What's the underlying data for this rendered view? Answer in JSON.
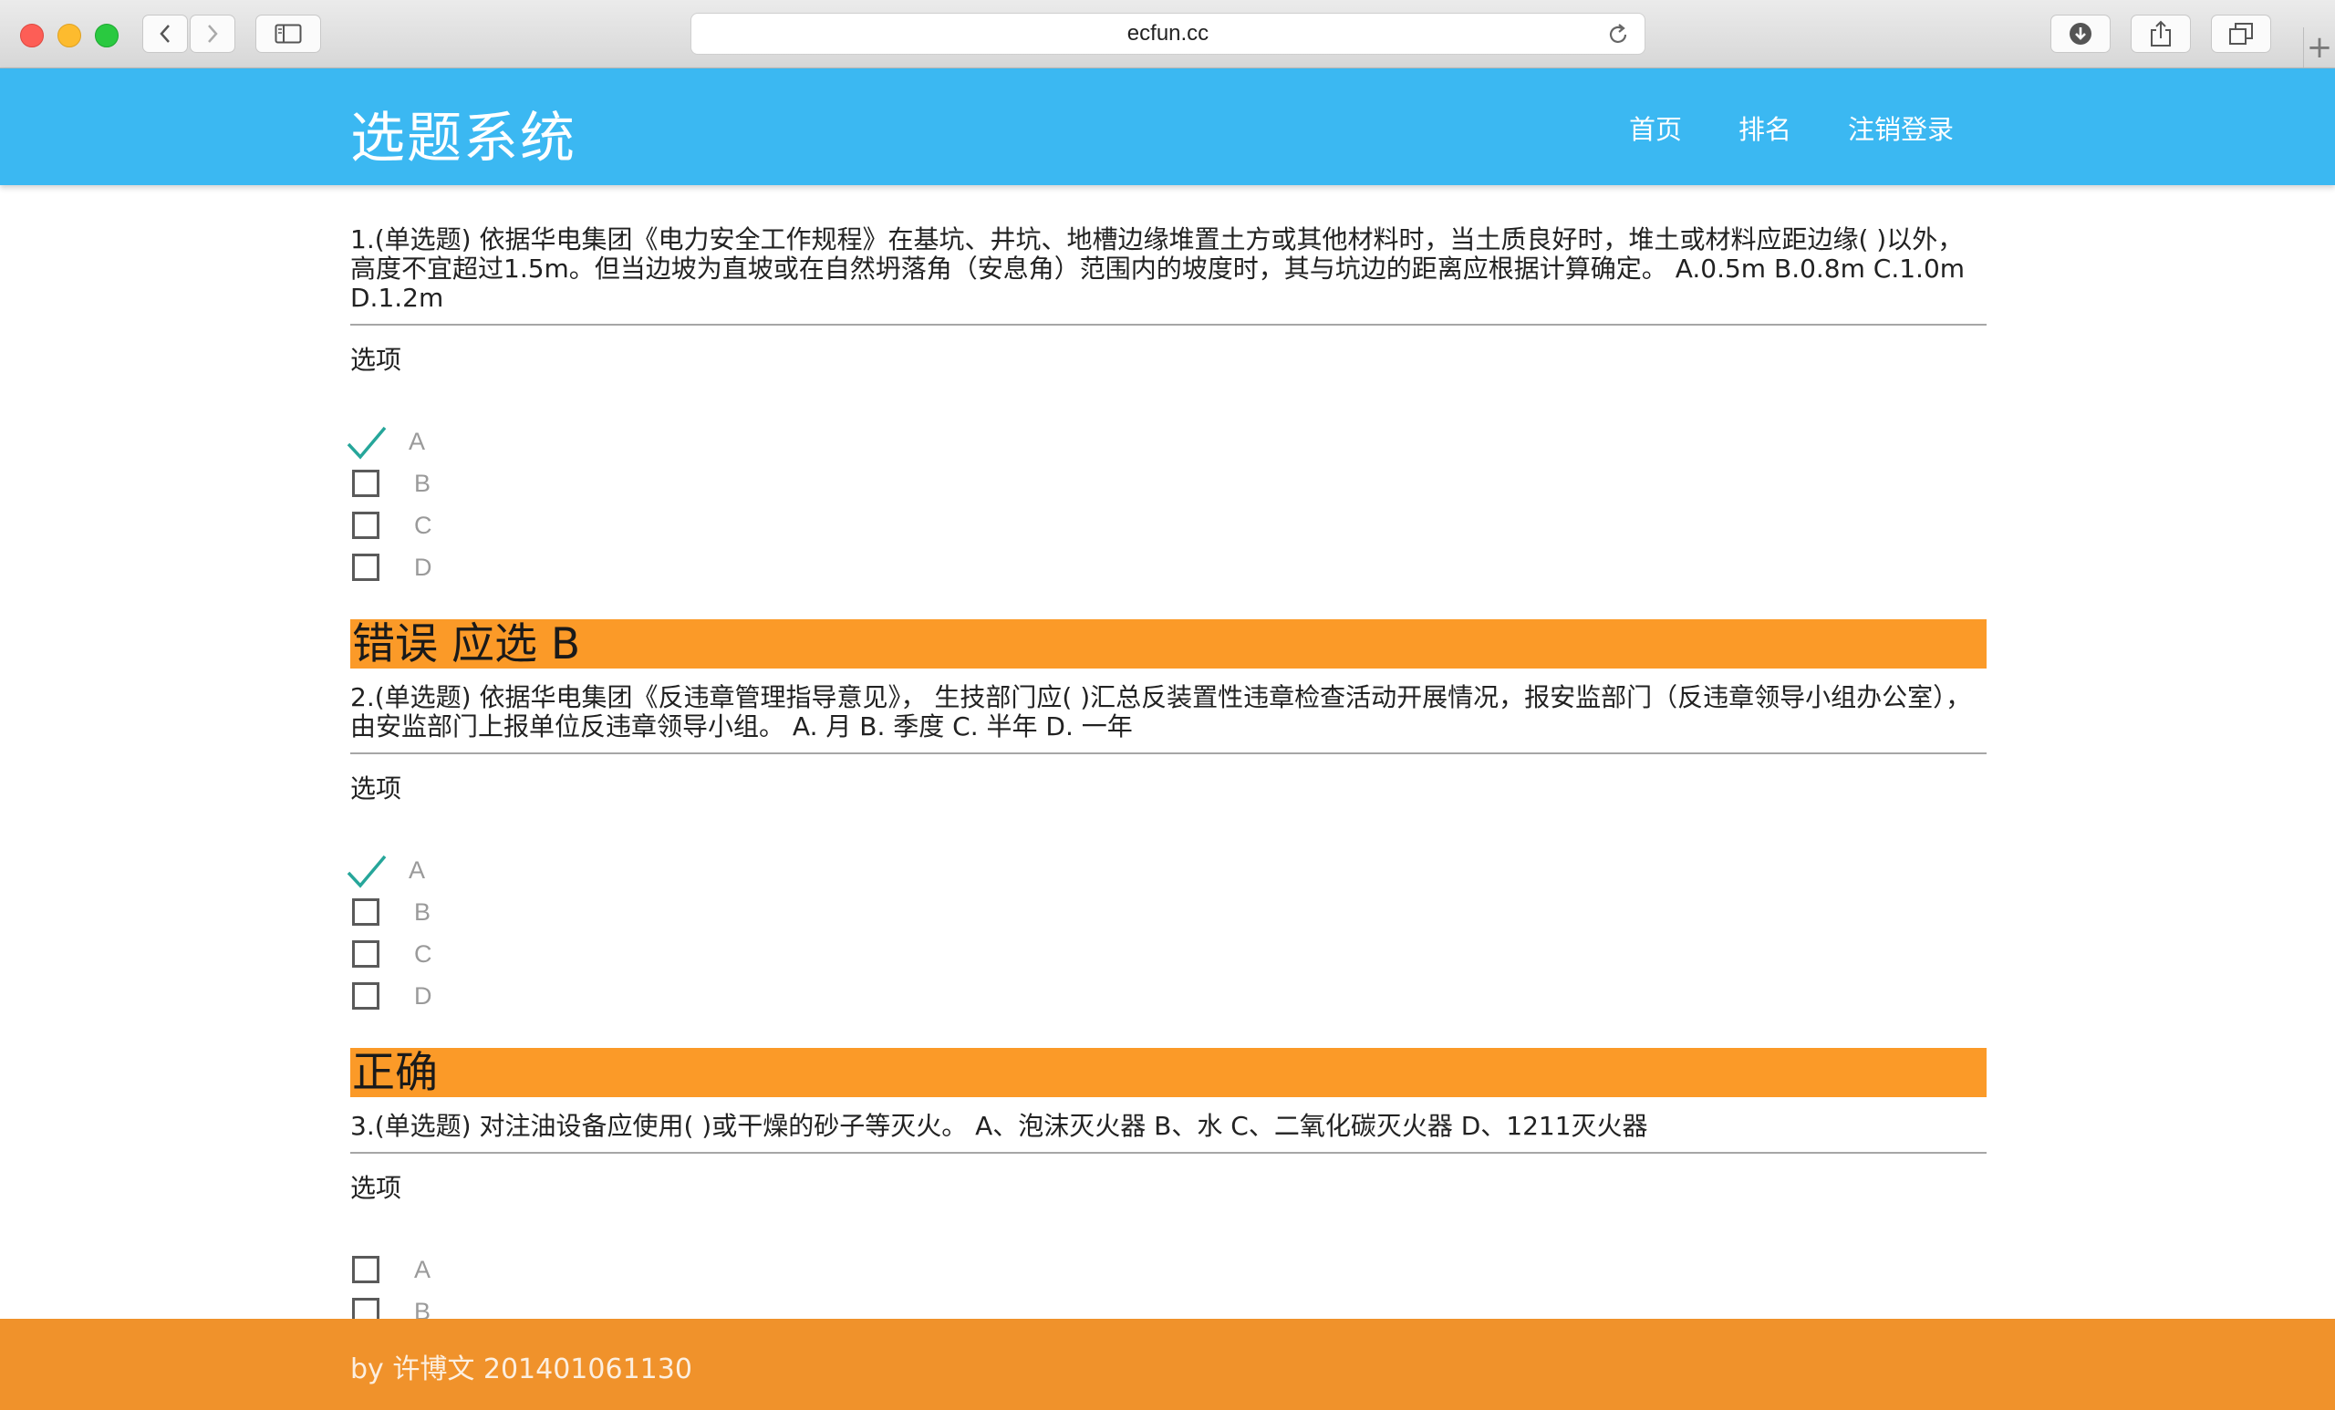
{
  "browser": {
    "url": "ecfun.cc"
  },
  "header": {
    "title": "选题系统",
    "nav": {
      "home": "首页",
      "rank": "排名",
      "logout": "注销登录"
    }
  },
  "questions": [
    {
      "text": "1.(单选题) 依据华电集团《电力安全工作规程》在基坑、井坑、地槽边缘堆置土方或其他材料时，当土质良好时，堆土或材料应距边缘( )以外，高度不宜超过1.5m。但当边坡为直坡或在自然坍落角（安息角）范围内的坡度时，其与坑边的距离应根据计算确定。 A.0.5m B.0.8m C.1.0m D.1.2m",
      "options_label": "选项",
      "options": [
        {
          "letter": "A",
          "checked": true
        },
        {
          "letter": "B",
          "checked": false
        },
        {
          "letter": "C",
          "checked": false
        },
        {
          "letter": "D",
          "checked": false
        }
      ],
      "result": "错误 应选 B"
    },
    {
      "text": "2.(单选题) 依据华电集团《反违章管理指导意见》， 生技部门应( )汇总反装置性违章检查活动开展情况，报安监部门（反违章领导小组办公室），由安监部门上报单位反违章领导小组。 A. 月 B. 季度 C. 半年 D. 一年",
      "options_label": "选项",
      "options": [
        {
          "letter": "A",
          "checked": true
        },
        {
          "letter": "B",
          "checked": false
        },
        {
          "letter": "C",
          "checked": false
        },
        {
          "letter": "D",
          "checked": false
        }
      ],
      "result": "正确"
    },
    {
      "text": "3.(单选题) 对注油设备应使用( )或干燥的砂子等灭火。 A、泡沫灭火器 B、水 C、二氧化碳灭火器 D、1211灭火器",
      "options_label": "选项",
      "options": [
        {
          "letter": "A",
          "checked": false
        },
        {
          "letter": "B",
          "checked": false
        }
      ]
    }
  ],
  "footer": {
    "text": "by 许博文 201401061130"
  },
  "colors": {
    "header": "#3bb8f2",
    "result_bar": "#fb9a28",
    "footer": "#f0922b",
    "check": "#26a69a"
  }
}
